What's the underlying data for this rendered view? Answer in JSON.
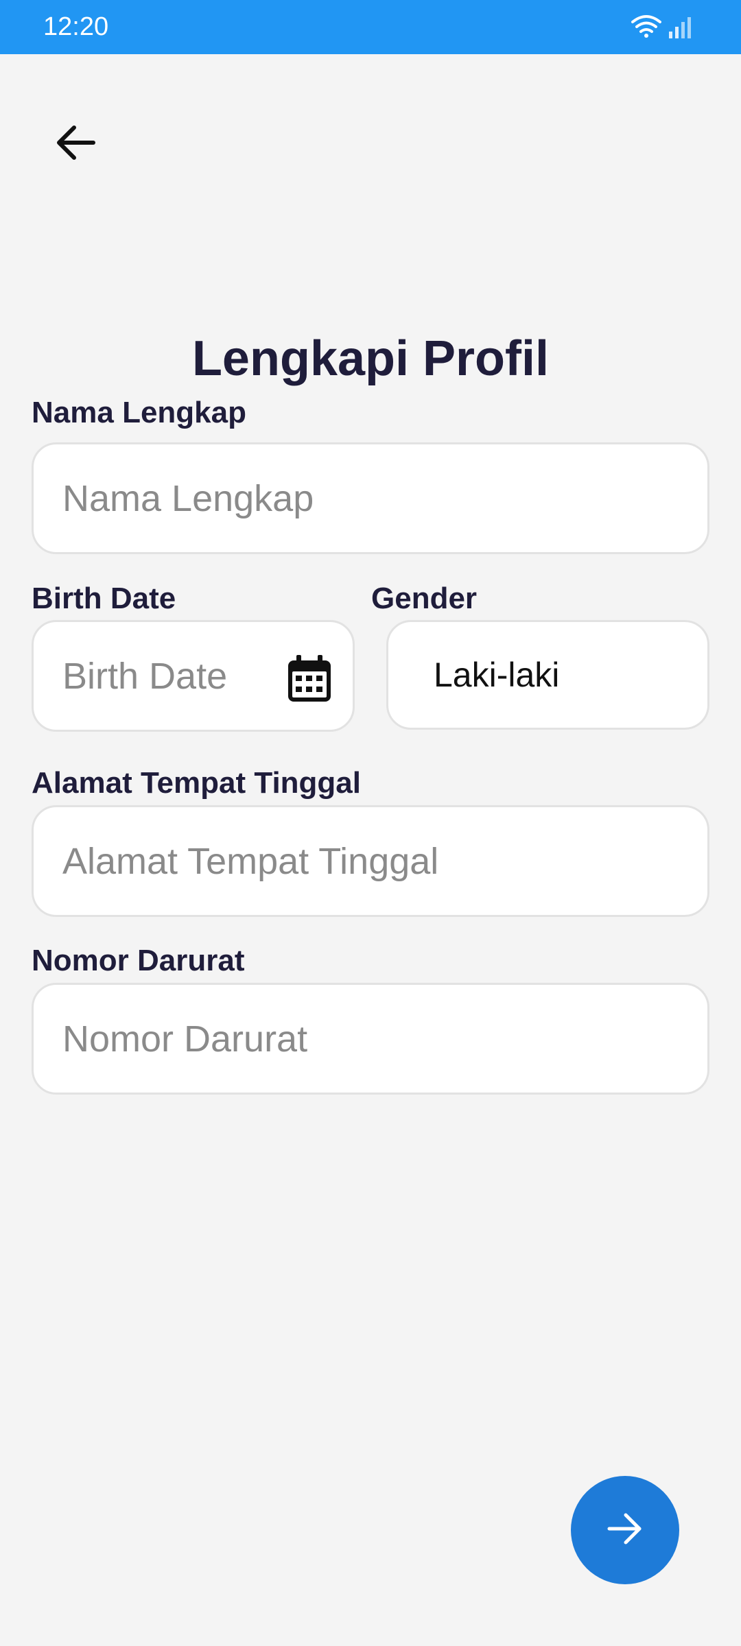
{
  "status_bar": {
    "time": "12:20",
    "icons": [
      "wifi-icon",
      "signal-icon"
    ],
    "background": "#2196f3"
  },
  "header": {
    "back_icon": "arrow-left-icon"
  },
  "page": {
    "title": "Lengkapi Profil"
  },
  "form": {
    "full_name": {
      "label": "Nama Lengkap",
      "placeholder": "Nama Lengkap",
      "value": ""
    },
    "birth_date": {
      "label": "Birth Date",
      "placeholder": "Birth Date",
      "value": "",
      "icon": "calendar-icon"
    },
    "gender": {
      "label": "Gender",
      "value": "Laki-laki"
    },
    "address": {
      "label": "Alamat Tempat Tinggal",
      "placeholder": "Alamat Tempat Tinggal",
      "value": ""
    },
    "emergency_number": {
      "label": "Nomor Darurat",
      "placeholder": "Nomor Darurat",
      "value": ""
    }
  },
  "actions": {
    "next_icon": "arrow-right-icon",
    "accent": "#1e7bd8"
  }
}
